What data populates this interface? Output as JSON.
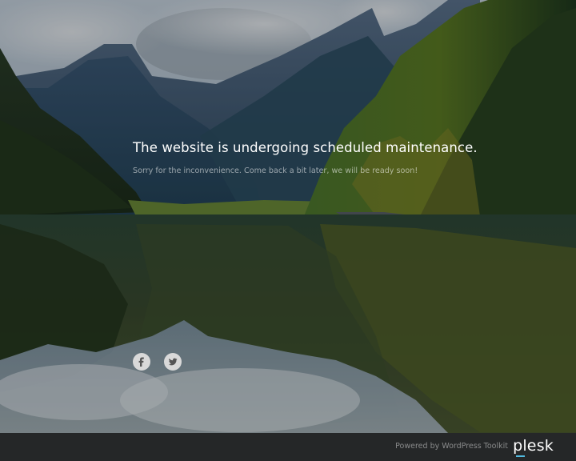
{
  "maintenance": {
    "title": "The website is undergoing scheduled maintenance.",
    "subtitle": "Sorry for the inconvenience. Come back a bit later, we will be ready soon!"
  },
  "social": [
    {
      "name": "facebook",
      "icon": "facebook-icon",
      "glyph": "f"
    },
    {
      "name": "twitter",
      "icon": "twitter-icon"
    }
  ],
  "footer": {
    "powered_by": "Powered by WordPress Toolkit",
    "logo_text": "plesk"
  },
  "colors": {
    "overlay": "#000000",
    "footer_bg": "#282828",
    "logo_accent": "#52bbe0",
    "social_bg": "#d9d9d9"
  }
}
